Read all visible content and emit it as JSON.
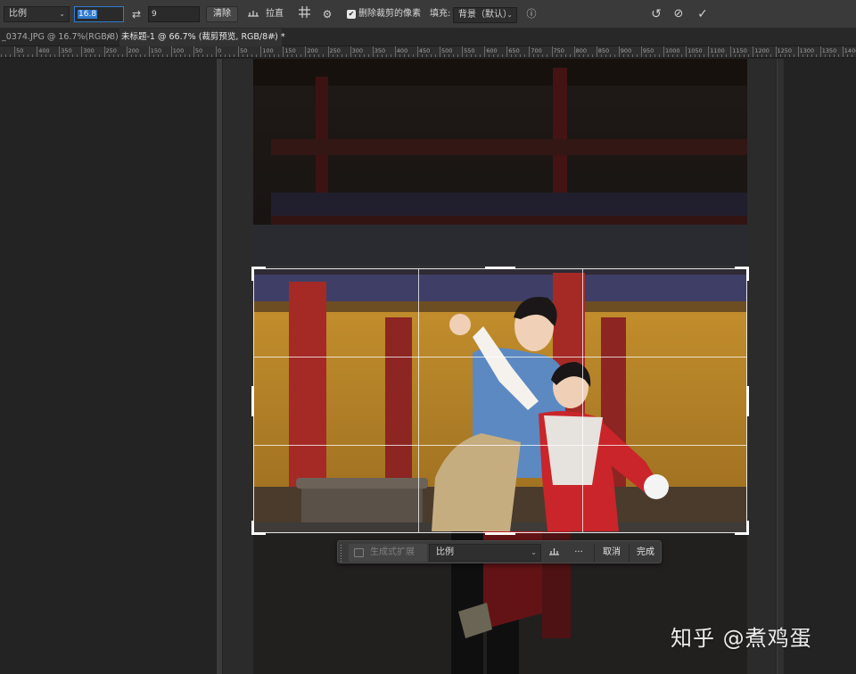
{
  "options_bar": {
    "ratio_preset": "比例",
    "width_value": "16.8",
    "height_value": "9",
    "clear_label": "清除",
    "straighten_label": "拉直",
    "delete_cropped_label": "删除裁剪的像素",
    "delete_cropped_checked": true,
    "fill_label": "填充:",
    "fill_value": "背景（默认）"
  },
  "tabs": [
    {
      "label": "_0374.JPG @ 16.7%(RGB/8) *",
      "active": false
    },
    {
      "label": "未标题-1 @ 66.7% (裁剪预览, RGB/8#) *",
      "active": true
    }
  ],
  "ruler": {
    "labels": [
      "0",
      "50",
      "400",
      "350",
      "300",
      "250",
      "200",
      "150",
      "100",
      "50",
      "0",
      "50",
      "100",
      "150",
      "200",
      "250",
      "300",
      "350",
      "400",
      "450",
      "500",
      "550",
      "600",
      "650",
      "700",
      "750",
      "800",
      "850",
      "900",
      "950",
      "1000",
      "1050",
      "1100",
      "1150",
      "1200",
      "1250",
      "1300",
      "1350",
      "1400"
    ]
  },
  "task_bar": {
    "generative_expand_label": "生成式扩展",
    "ratio_value": "比例",
    "more_label": "···",
    "cancel_label": "取消",
    "done_label": "完成"
  },
  "watermark": "知乎 @煮鸡蛋",
  "colors": {
    "app_bg": "#232323",
    "toolbar_bg": "#3a3a3a",
    "focus_blue": "#2f7ad1",
    "pillar_red": "#a52a26",
    "wall_yellow": "#b8872a",
    "costume_red": "#c9252a"
  }
}
